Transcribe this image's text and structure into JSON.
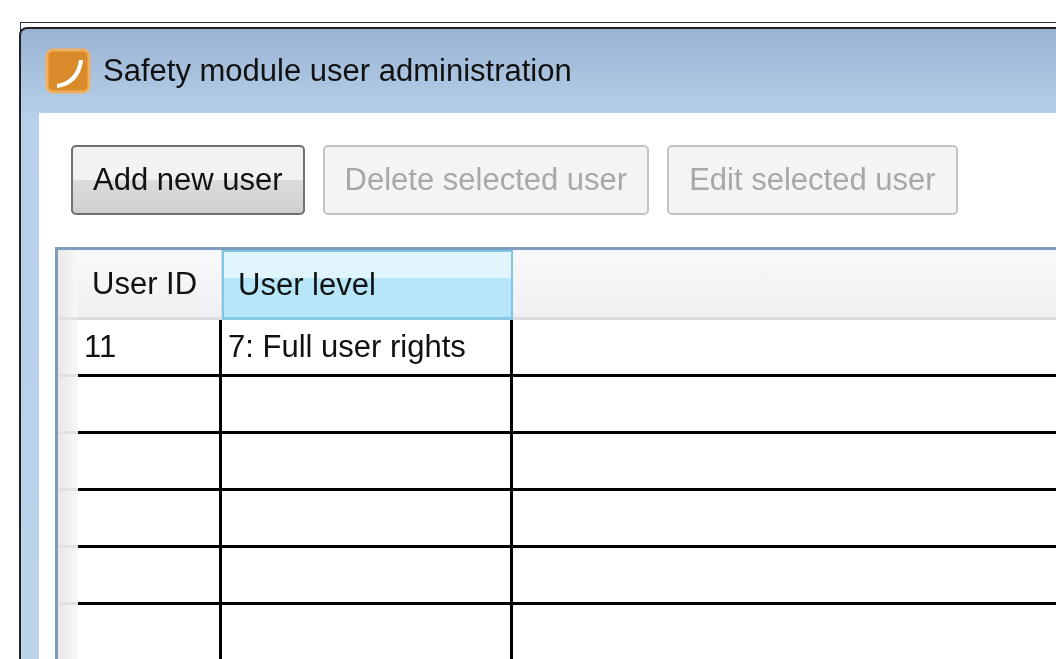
{
  "window": {
    "title": "Safety module user administration"
  },
  "buttons": [
    {
      "label": "Add new user",
      "disabled": false
    },
    {
      "label": "Delete selected user",
      "disabled": true
    },
    {
      "label": "Edit selected user",
      "disabled": true
    }
  ],
  "table": {
    "columns": [
      {
        "label": "User ID",
        "selected": false
      },
      {
        "label": "User level",
        "selected": true
      }
    ],
    "rows": [
      [
        "11",
        "7: Full user rights"
      ]
    ]
  }
}
